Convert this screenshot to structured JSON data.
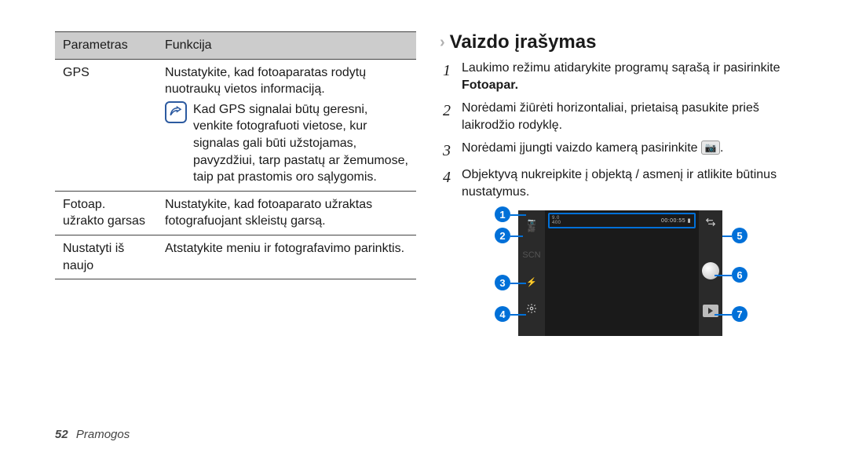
{
  "table": {
    "headers": {
      "param": "Parametras",
      "func": "Funkcija"
    },
    "rows": [
      {
        "param": "GPS",
        "func_intro": "Nustatykite, kad fotoaparatas rodytų nuotraukų vietos informaciją.",
        "note": "Kad GPS signalai būtų geresni, venkite fotografuoti vietose, kur signalas gali būti užstojamas, pavyzdžiui, tarp pastatų ar žemumose, taip pat prastomis oro sąlygomis."
      },
      {
        "param": "Fotoap. užrakto garsas",
        "func": "Nustatykite, kad fotoaparato užraktas fotografuojant skleistų garsą."
      },
      {
        "param": "Nustatyti iš naujo",
        "func": "Atstatykite meniu ir fotografavimo parinktis."
      }
    ]
  },
  "heading": "Vaizdo įrašymas",
  "steps": [
    {
      "n": "1",
      "pre": "Laukimo režimu atidarykite programų sąrašą ir pasirinkite ",
      "bold": "Fotoapar."
    },
    {
      "n": "2",
      "text": "Norėdami žiūrėti horizontaliai, prietaisą pasukite prieš laikrodžio rodyklę."
    },
    {
      "n": "3",
      "pre": "Norėdami įjungti vaizdo kamerą pasirinkite ",
      "icon": "camera",
      "post": "."
    },
    {
      "n": "4",
      "text": "Objektyvą nukreipkite į objektą / asmenį ir atlikite būtinus nustatymus."
    }
  ],
  "camera": {
    "hud_time": "00:00:55",
    "scn_label": "SCN"
  },
  "callouts": {
    "1": "1",
    "2": "2",
    "3": "3",
    "4": "4",
    "5": "5",
    "6": "6",
    "7": "7"
  },
  "footer": {
    "page": "52",
    "section": "Pramogos"
  }
}
